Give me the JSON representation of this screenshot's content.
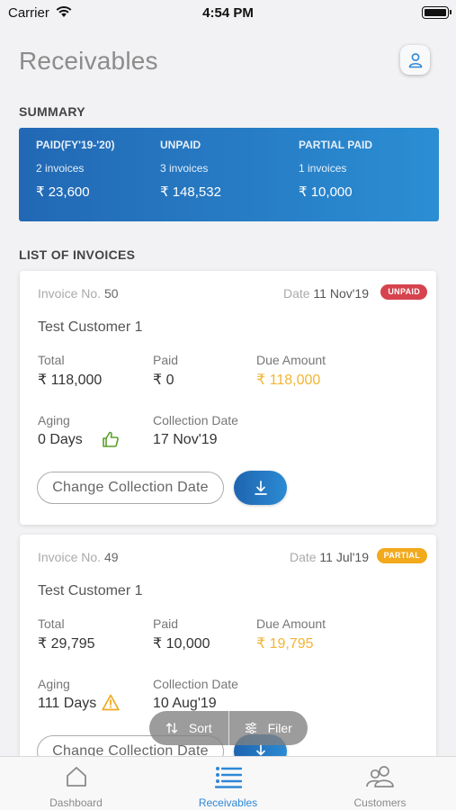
{
  "status_bar": {
    "carrier": "Carrier",
    "time": "4:54 PM"
  },
  "header": {
    "title": "Receivables"
  },
  "summary": {
    "label": "SUMMARY",
    "columns": [
      {
        "label": "PAID(FY'19-'20)",
        "count": "2 invoices",
        "amount": "₹ 23,600"
      },
      {
        "label": "UNPAID",
        "count": "3 invoices",
        "amount": "₹ 148,532"
      },
      {
        "label": "PARTIAL PAID",
        "count": "1 invoices",
        "amount": "₹ 10,000"
      }
    ]
  },
  "invoices_label": "LIST OF INVOICES",
  "invoices": [
    {
      "invoice_no_label": "Invoice No.",
      "invoice_no": "50",
      "date_label": "Date",
      "date": "11 Nov'19",
      "status": "UNPAID",
      "customer": "Test Customer 1",
      "total_label": "Total",
      "total": "₹ 118,000",
      "paid_label": "Paid",
      "paid": "₹ 0",
      "due_label": "Due Amount",
      "due": "₹ 118,000",
      "aging_label": "Aging",
      "aging": "0 Days",
      "collection_label": "Collection Date",
      "collection": "17 Nov'19",
      "change_button": "Change Collection Date"
    },
    {
      "invoice_no_label": "Invoice No.",
      "invoice_no": "49",
      "date_label": "Date",
      "date": "11 Jul'19",
      "status": "PARTIAL",
      "customer": "Test Customer 1",
      "total_label": "Total",
      "total": "₹ 29,795",
      "paid_label": "Paid",
      "paid": "₹ 10,000",
      "due_label": "Due Amount",
      "due": "₹ 19,795",
      "aging_label": "Aging",
      "aging": "111 Days",
      "collection_label": "Collection Date",
      "collection": "10 Aug'19",
      "change_button": "Change Collection Date"
    }
  ],
  "sort_filter": {
    "sort": "Sort",
    "filter": "Filer"
  },
  "tabs": [
    {
      "label": "Dashboard",
      "icon": "home-icon"
    },
    {
      "label": "Receivables",
      "icon": "list-icon",
      "active": true
    },
    {
      "label": "Customers",
      "icon": "users-icon"
    }
  ],
  "colors": {
    "accent": "#2e87d6",
    "unpaid_badge": "#d6434e",
    "partial_badge": "#f2a91c",
    "due_amount": "#f2b534",
    "thumbs_up": "#5aa02c",
    "warning": "#f2a91c"
  }
}
